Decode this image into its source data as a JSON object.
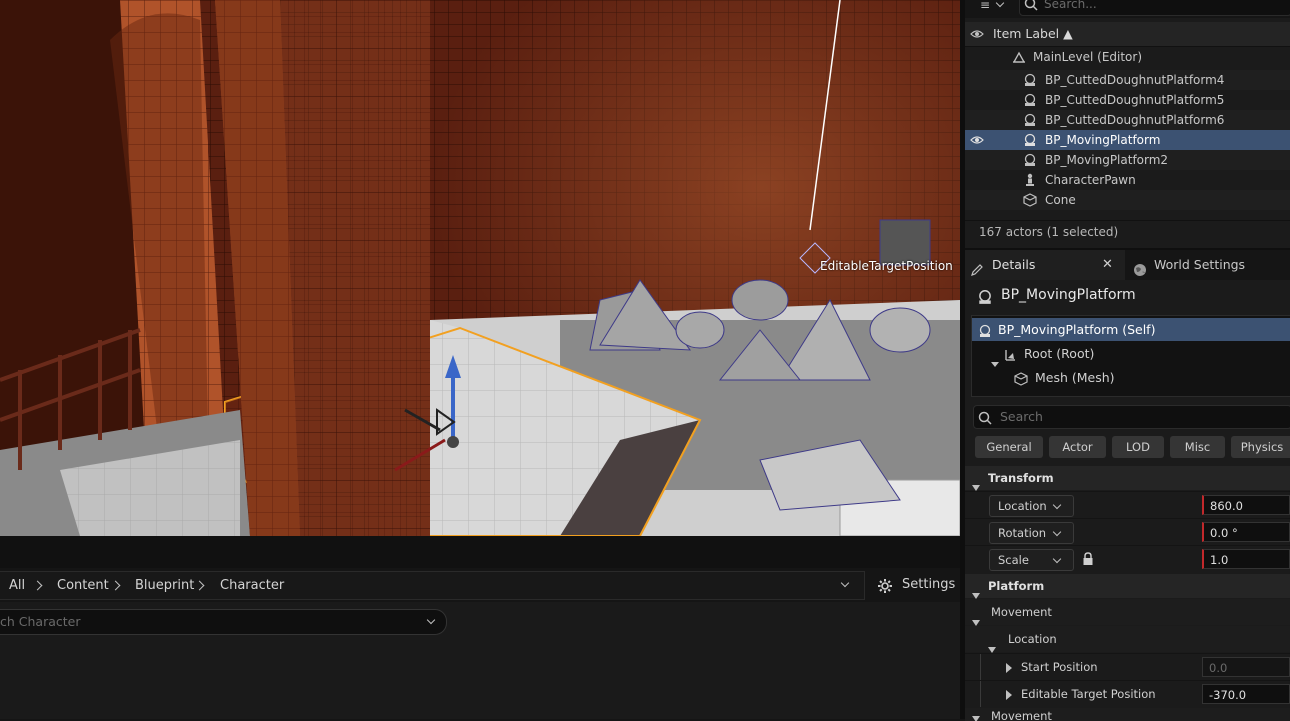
{
  "viewport": {
    "label": "EditableTargetPosition"
  },
  "outliner": {
    "search_placeholder": "Search...",
    "header_label": "Item Label ▲",
    "level_item": "MainLevel (Editor)",
    "items": [
      {
        "label": "BP_CuttedDoughnutPlatform4",
        "icon": "blueprint-actor-icon"
      },
      {
        "label": "BP_CuttedDoughnutPlatform5",
        "icon": "blueprint-actor-icon"
      },
      {
        "label": "BP_CuttedDoughnutPlatform6",
        "icon": "blueprint-actor-icon"
      },
      {
        "label": "BP_MovingPlatform",
        "icon": "blueprint-actor-icon",
        "selected": true
      },
      {
        "label": "BP_MovingPlatform2",
        "icon": "blueprint-actor-icon"
      },
      {
        "label": "CharacterPawn",
        "icon": "pawn-icon"
      },
      {
        "label": "Cone",
        "icon": "static-mesh-icon"
      }
    ],
    "footer": "167 actors (1 selected)"
  },
  "details": {
    "tab_details": "Details",
    "tab_world_settings": "World Settings",
    "actor_title": "BP_MovingPlatform",
    "components": {
      "self": "BP_MovingPlatform (Self)",
      "root": "Root (Root)",
      "mesh": "Mesh (Mesh)"
    },
    "search_placeholder": "Search",
    "filters": [
      "General",
      "Actor",
      "LOD",
      "Misc",
      "Physics"
    ],
    "transform": {
      "header": "Transform",
      "location_label": "Location",
      "location_value": "860.0",
      "rotation_label": "Rotation",
      "rotation_value": "0.0 °",
      "scale_label": "Scale",
      "scale_value": "1.0"
    },
    "platform": {
      "header": "Platform",
      "movement_label": "Movement",
      "location_label": "Location",
      "start_position_label": "Start Position",
      "start_position_value": "0.0",
      "editable_target_label": "Editable Target Position",
      "editable_target_value": "-370.0",
      "movement2_label": "Movement"
    }
  },
  "content_browser": {
    "breadcrumbs": [
      "All",
      "Content",
      "Blueprint",
      "Character"
    ],
    "settings_label": "Settings",
    "search_placeholder": "ch Character"
  },
  "colors": {
    "selection": "#3c5272",
    "gizmo_blue": "#3a66c8",
    "selection_outline": "#f2a020"
  }
}
